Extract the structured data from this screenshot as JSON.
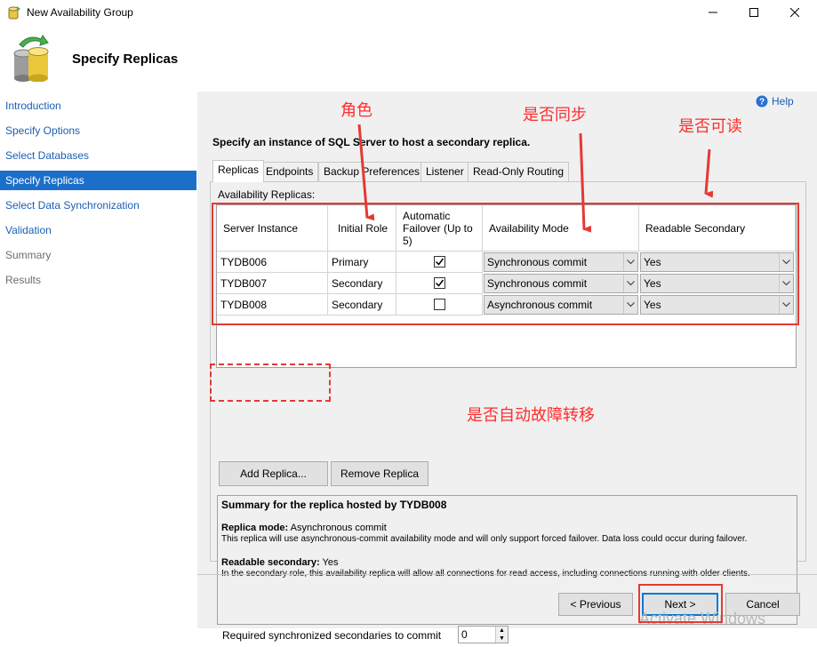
{
  "window": {
    "title": "New Availability Group"
  },
  "header": {
    "title": "Specify Replicas"
  },
  "nav": {
    "items": [
      {
        "label": "Introduction",
        "state": "normal"
      },
      {
        "label": "Specify Options",
        "state": "normal"
      },
      {
        "label": "Select Databases",
        "state": "normal"
      },
      {
        "label": "Specify Replicas",
        "state": "selected"
      },
      {
        "label": "Select Data Synchronization",
        "state": "normal"
      },
      {
        "label": "Validation",
        "state": "normal"
      },
      {
        "label": "Summary",
        "state": "disabled"
      },
      {
        "label": "Results",
        "state": "disabled"
      }
    ]
  },
  "help": {
    "label": "Help"
  },
  "instruction": "Specify an instance of SQL Server to host a secondary replica.",
  "tabs": [
    "Replicas",
    "Endpoints",
    "Backup Preferences",
    "Listener",
    "Read-Only Routing"
  ],
  "grid": {
    "label": "Availability Replicas:",
    "columns": [
      "Server Instance",
      "Initial Role",
      "Automatic Failover (Up to 5)",
      "Availability Mode",
      "Readable Secondary"
    ],
    "rows": [
      {
        "server": "TYDB006",
        "role": "Primary",
        "failover": true,
        "mode": "Synchronous commit",
        "readable": "Yes"
      },
      {
        "server": "TYDB007",
        "role": "Secondary",
        "failover": true,
        "mode": "Synchronous commit",
        "readable": "Yes"
      },
      {
        "server": "TYDB008",
        "role": "Secondary",
        "failover": false,
        "mode": "Asynchronous commit",
        "readable": "Yes"
      }
    ]
  },
  "buttons": {
    "add_replica": "Add Replica...",
    "remove_replica": "Remove Replica",
    "previous": "< Previous",
    "next": "Next >",
    "cancel": "Cancel"
  },
  "summary": {
    "title": "Summary for the replica hosted by TYDB008",
    "mode_label": "Replica mode:",
    "mode_value": "Asynchronous commit",
    "mode_desc": "This replica will use asynchronous-commit availability mode and will only support forced failover. Data loss could occur during failover.",
    "readable_label": "Readable secondary:",
    "readable_value": "Yes",
    "readable_desc": "In the secondary role, this availability replica will allow all connections for read access, including connections running with older clients."
  },
  "required": {
    "label": "Required synchronized secondaries to commit",
    "value": "0"
  },
  "annotations": {
    "role": "角色",
    "sync": "是否同步",
    "readable": "是否可读",
    "failover": "是否自动故障转移"
  },
  "watermark": "Activate Windows",
  "colors": {
    "nav_selected": "#1c6fc9",
    "link": "#1a5fb4",
    "annotation": "#ff2d2d",
    "default_button_border": "#0078d7"
  }
}
